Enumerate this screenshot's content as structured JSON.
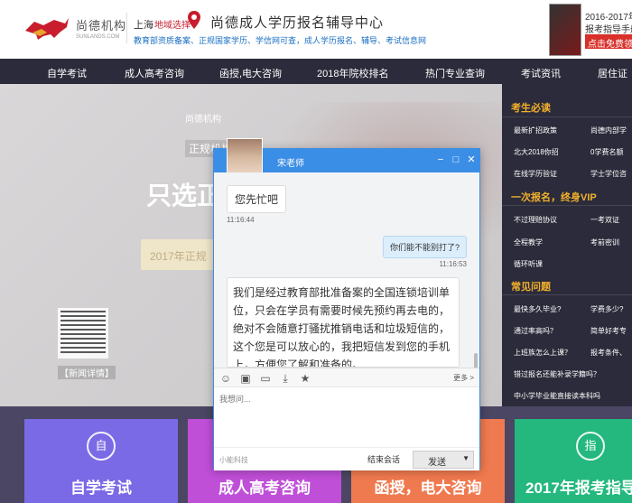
{
  "header": {
    "logo_cn": "尚德机构",
    "logo_en": "SUNLANDS.COM",
    "city": "上海",
    "city_select": "地域选择",
    "site_title": "尚德成人学历报名辅导中心",
    "sub_links": "教育部资质备案、正规国家学历、学信网可查，成人学历报名、辅导、考试信息网",
    "promo_year": "2016-2017年",
    "promo_sub": "报考指导手册",
    "promo_btn": "点击免费领"
  },
  "nav": [
    "自学考试",
    "成人高考咨询",
    "函授,电大咨询",
    "2018年院校排名",
    "热门专业查询",
    "考试资讯",
    "居住证"
  ],
  "hero": {
    "logo_text": "尚德机构",
    "tag": "正规机构",
    "big_text": "只选正",
    "pill": "2017年正规",
    "qr_label": "【新闻详情】"
  },
  "sidebar": {
    "sec1_title": "考生必读",
    "sec1_rows": [
      [
        "最新扩招政策",
        "尚德内部学"
      ],
      [
        "北大2018你招",
        "0学费名额"
      ],
      [
        "在线学历验证",
        "学士学位咨"
      ]
    ],
    "sec2_title": "一次报名，终身VIP",
    "sec2_rows": [
      [
        "不过理赔协议",
        "一考双证"
      ],
      [
        "全程教学",
        "考前密训"
      ],
      [
        "循环听课",
        ""
      ]
    ],
    "sec3_title": "常见问题",
    "sec3_rows": [
      [
        "最快多久毕业?",
        "学费多少?"
      ],
      [
        "通过率高吗？",
        "简单好考专"
      ],
      [
        "上班族怎么上课？",
        "报考条件、"
      ],
      [
        "错过报名还能补录学籍吗？",
        ""
      ],
      [
        "中小学毕业能直接读本科吗",
        ""
      ]
    ]
  },
  "cards": [
    {
      "title": "自学考试",
      "icon": "自",
      "color": "#7b6ae6"
    },
    {
      "title": "成人高考咨询",
      "icon": "成",
      "color": "#c04fd8"
    },
    {
      "title": "函授，电大咨询",
      "icon": "函",
      "color": "#f07a4f"
    },
    {
      "title": "2017年报考指导",
      "icon": "指",
      "color": "#24b87e"
    }
  ],
  "chat": {
    "agent_name": "宋老师",
    "msg1": "您先忙吧",
    "time1": "11:16:44",
    "msg2": "你们能不能别打了?",
    "time2": "11:16:53",
    "msg3": "我们是经过教育部批准备案的全国连锁培训单位，只会在学员有需要时候先预约再去电的，绝对不会随意打骚扰推销电话和垃圾短信的，这个您是可以放心的，我把短信发到您的手机上，方便您了解和准备的。",
    "more": "更多 >",
    "input_placeholder": "我想问...",
    "brand": "小能科技",
    "end_label": "结束会话",
    "send_label": "发送"
  }
}
